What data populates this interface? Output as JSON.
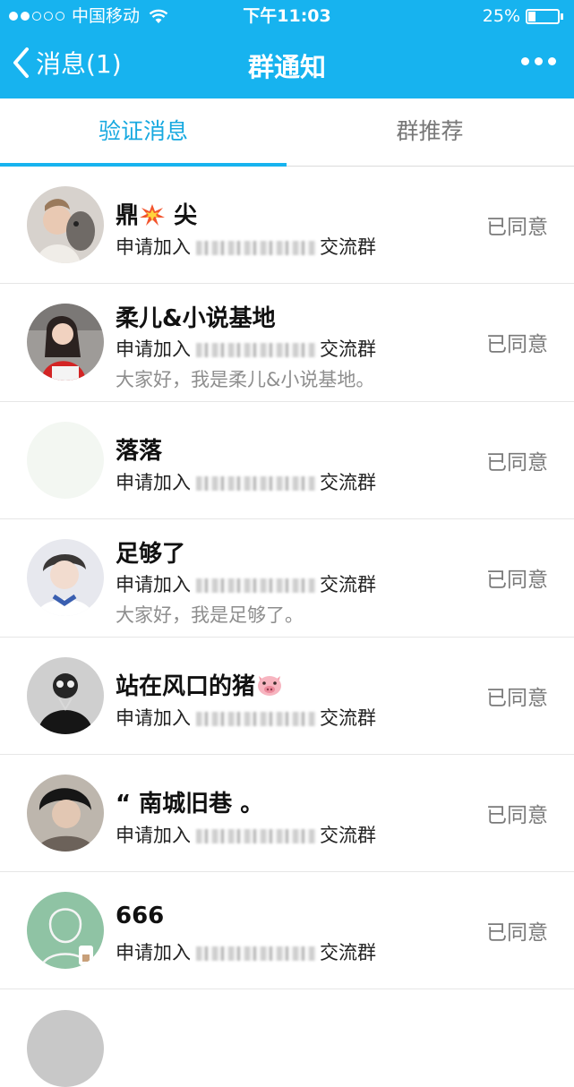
{
  "status_bar": {
    "carrier": "中国移动",
    "time": "下午11:03",
    "battery": "25%",
    "battery_level": 0.25
  },
  "nav": {
    "back_label": "消息(1)",
    "title": "群通知",
    "more_icon": "more-dots-icon"
  },
  "tabs": [
    {
      "label": "验证消息",
      "active": true
    },
    {
      "label": "群推荐",
      "active": false
    }
  ],
  "accent_color": "#17b3ef",
  "requests": [
    {
      "name": "鼎",
      "name_suffix": "尖",
      "name_emoji": "collision-icon",
      "apply_prefix": "申请加入",
      "apply_suffix": "交流群",
      "status": "已同意"
    },
    {
      "name": "柔儿&小说基地",
      "apply_prefix": "申请加入",
      "apply_suffix": "交流群",
      "greeting": "大家好，我是柔儿&小说基地。",
      "status": "已同意"
    },
    {
      "name": "落落",
      "apply_prefix": "申请加入",
      "apply_suffix": "交流群",
      "status": "已同意"
    },
    {
      "name": "足够了",
      "apply_prefix": "申请加入",
      "apply_suffix": "交流群",
      "greeting": "大家好，我是足够了。",
      "status": "已同意"
    },
    {
      "name": "站在风口的猪",
      "name_emoji": "pig-face-icon",
      "apply_prefix": "申请加入",
      "apply_suffix": "交流群",
      "status": "已同意"
    },
    {
      "name": "“ 南城旧巷 。",
      "apply_prefix": "申请加入",
      "apply_suffix": "交流群",
      "status": "已同意"
    },
    {
      "name": "666",
      "apply_prefix": "申请加入",
      "apply_suffix": "交流群",
      "status": "已同意"
    }
  ]
}
